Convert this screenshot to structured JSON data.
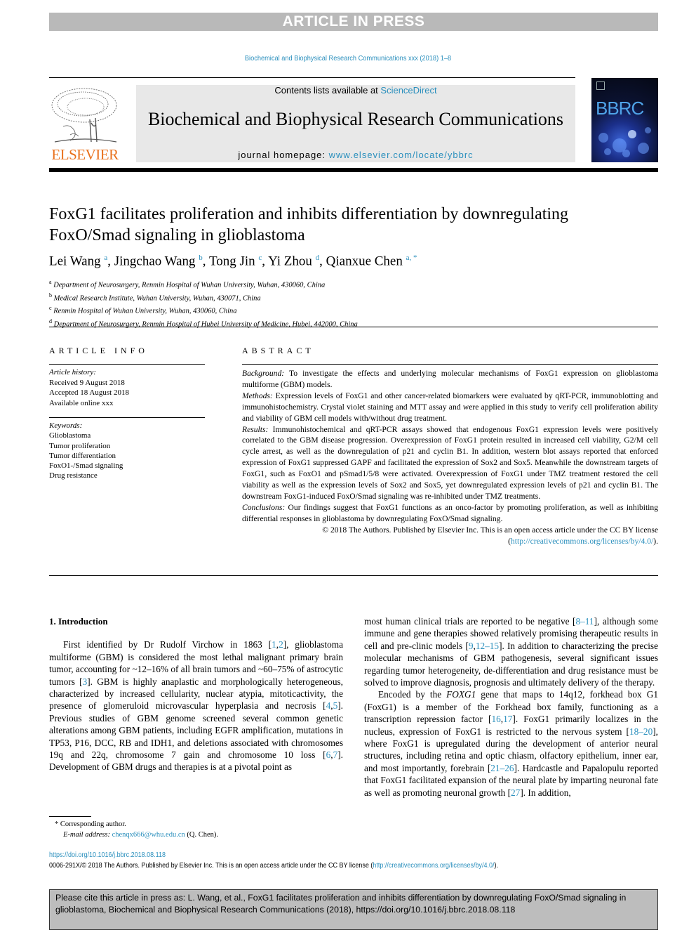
{
  "banner": {
    "label": "ARTICLE IN PRESS"
  },
  "running_head": "Biochemical and Biophysical Research Communications xxx (2018) 1–8",
  "masthead": {
    "publisher": "ELSEVIER",
    "contents_prefix": "Contents lists available at ",
    "contents_link": "ScienceDirect",
    "journal_name": "Biochemical and Biophysical Research Communications",
    "homepage_prefix": "journal homepage: ",
    "homepage_link": "www.elsevier.com/locate/ybbrc",
    "cover_title": "BBRC",
    "accent_color": "#2a8fbd",
    "publisher_color": "#e9711c"
  },
  "article": {
    "title": "FoxG1 facilitates proliferation and inhibits differentiation by downregulating FoxO/Smad signaling in glioblastoma",
    "authors": [
      {
        "name": "Lei Wang",
        "sup": "a"
      },
      {
        "name": "Jingchao Wang",
        "sup": "b"
      },
      {
        "name": "Tong Jin",
        "sup": "c"
      },
      {
        "name": "Yi Zhou",
        "sup": "d"
      },
      {
        "name": "Qianxue Chen",
        "sup": "a, *"
      }
    ],
    "affiliations": [
      {
        "key": "a",
        "text": "Department of Neurosurgery, Renmin Hospital of Wuhan University, Wuhan, 430060, China"
      },
      {
        "key": "b",
        "text": "Medical Research Institute, Wuhan University, Wuhan, 430071, China"
      },
      {
        "key": "c",
        "text": "Renmin Hospital of Wuhan University, Wuhan, 430060, China"
      },
      {
        "key": "d",
        "text": "Department of Neurosurgery, Renmin Hospital of Hubei University of Medicine, Hubei, 442000, China"
      }
    ]
  },
  "article_info": {
    "heading": "ARTICLE INFO",
    "history_label": "Article history:",
    "history": [
      "Received 9 August 2018",
      "Accepted 18 August 2018",
      "Available online xxx"
    ],
    "keywords_label": "Keywords:",
    "keywords": [
      "Glioblastoma",
      "Tumor proliferation",
      "Tumor differentiation",
      "FoxO1-/Smad signaling",
      "Drug resistance"
    ]
  },
  "abstract": {
    "heading": "ABSTRACT",
    "sections": [
      {
        "label": "Background:",
        "text": " To investigate the effects and underlying molecular mechanisms of FoxG1 expression on glioblastoma multiforme (GBM) models."
      },
      {
        "label": "Methods:",
        "text": " Expression levels of FoxG1 and other cancer-related biomarkers were evaluated by qRT-PCR, immunoblotting and immunohistochemistry. Crystal violet staining and MTT assay and were applied in this study to verify cell proliferation ability and viability of GBM cell models with/without drug treatment."
      },
      {
        "label": "Results:",
        "text": " Immunohistochemical and qRT-PCR assays showed that endogenous FoxG1 expression levels were positively correlated to the GBM disease progression. Overexpression of FoxG1 protein resulted in increased cell viability, G2/M cell cycle arrest, as well as the downregulation of p21 and cyclin B1. In addition, western blot assays reported that enforced expression of FoxG1 suppressed GAPF and facilitated the expression of Sox2 and Sox5. Meanwhile the downstream targets of FoxG1, such as FoxO1 and pSmad1/5/8 were activated. Overexpression of FoxG1 under TMZ treatment restored the cell viability as well as the expression levels of Sox2 and Sox5, yet downregulated expression levels of p21 and cyclin B1. The downstream FoxG1-induced FoxO/Smad signaling was re-inhibited under TMZ treatments."
      },
      {
        "label": "Conclusions:",
        "text": " Our findings suggest that FoxG1 functions as an onco-factor by promoting proliferation, as well as inhibiting differential responses in glioblastoma by downregulating FoxO/Smad signaling."
      }
    ],
    "copyright": "© 2018 The Authors. Published by Elsevier Inc. This is an open access article under the CC BY license",
    "license_link": "http://creativecommons.org/licenses/by/4.0/"
  },
  "body": {
    "intro_heading": "1.  Introduction",
    "left_para": [
      {
        "t": "First identified by Dr Rudolf Virchow in 1863 ["
      },
      {
        "r": "1"
      },
      {
        "t": ","
      },
      {
        "r": "2"
      },
      {
        "t": "], glioblastoma multiforme (GBM) is considered the most lethal malignant primary brain tumor, accounting for ~12–16% of all brain tumors and ~60–75% of astrocytic tumors ["
      },
      {
        "r": "3"
      },
      {
        "t": "]. GBM is highly anaplastic and morphologically heterogeneous, characterized by increased cellularity, nuclear atypia, mitoticactivity, the presence of glomeruloid microvascular hyperplasia and necrosis ["
      },
      {
        "r": "4"
      },
      {
        "t": ","
      },
      {
        "r": "5"
      },
      {
        "t": "]. Previous studies of GBM genome screened several common genetic alterations among GBM patients, including EGFR amplification, mutations in TP53, P16, DCC, RB and IDH1, and deletions associated with chromosomes 19q and 22q, chromosome 7 gain and chromosome 10 loss ["
      },
      {
        "r": "6"
      },
      {
        "t": ","
      },
      {
        "r": "7"
      },
      {
        "t": "]. Development of GBM drugs and therapies is at a pivotal point as"
      }
    ],
    "right_para1": [
      {
        "t": "most human clinical trials are reported to be negative ["
      },
      {
        "r": "8–11"
      },
      {
        "t": "], although some immune and gene therapies showed relatively promising therapeutic results in cell and pre-clinic models ["
      },
      {
        "r": "9"
      },
      {
        "t": ","
      },
      {
        "r": "12–15"
      },
      {
        "t": "]. In addition to characterizing the precise molecular mechanisms of GBM pathogenesis, several significant issues regarding tumor heterogeneity, de-differentiation and drug resistance must be solved to improve diagnosis, prognosis and ultimately delivery of the therapy."
      }
    ],
    "right_para2": [
      {
        "t": "Encoded by the "
      },
      {
        "i": "FOXG1"
      },
      {
        "t": " gene that maps to 14q12, forkhead box G1 (FoxG1) is a member of the Forkhead box family, functioning as a transcription repression factor ["
      },
      {
        "r": "16"
      },
      {
        "t": ","
      },
      {
        "r": "17"
      },
      {
        "t": "]. FoxG1 primarily localizes in the nucleus, expression of FoxG1 is restricted to the nervous system ["
      },
      {
        "r": "18–20"
      },
      {
        "t": "], where FoxG1 is upregulated during the development of anterior neural structures, including retina and optic chiasm, olfactory epithelium, inner ear, and most importantly, forebrain ["
      },
      {
        "r": "21–26"
      },
      {
        "t": "]. Hardcastle and Papalopulu reported that FoxG1 facilitated expansion of the neural plate by imparting neuronal fate as well as promoting neuronal growth ["
      },
      {
        "r": "27"
      },
      {
        "t": "]. In addition,"
      }
    ]
  },
  "footnote": {
    "marker": "*",
    "corresponding": "Corresponding author.",
    "email_label": "E-mail address:",
    "email": "chenqx666@whu.edu.cn",
    "email_suffix": " (Q. Chen)."
  },
  "footer": {
    "doi": "https://doi.org/10.1016/j.bbrc.2018.08.118",
    "issn_text": "0006-291X/© 2018 The Authors. Published by Elsevier Inc. This is an open access article under the CC BY license (",
    "license_link": "http://creativecommons.org/licenses/by/4.0/",
    "issn_suffix": ")."
  },
  "cite_box": {
    "text": "Please cite this article in press as: L. Wang, et al., FoxG1 facilitates proliferation and inhibits differentiation by downregulating FoxO/Smad signaling in glioblastoma, Biochemical and Biophysical Research Communications (2018), https://doi.org/10.1016/j.bbrc.2018.08.118"
  }
}
